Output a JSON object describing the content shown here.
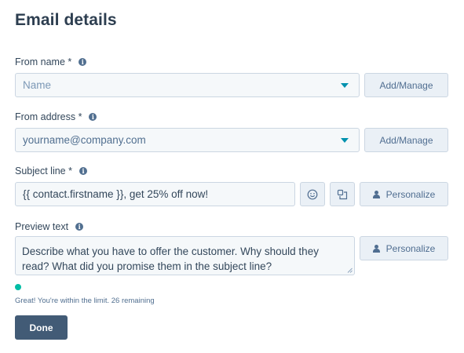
{
  "title": "Email details",
  "from_name": {
    "label": "From name *",
    "placeholder": "Name",
    "button": "Add/Manage"
  },
  "from_address": {
    "label": "From address *",
    "value": "yourname@company.com",
    "button": "Add/Manage"
  },
  "subject": {
    "label": "Subject line *",
    "value": "{{ contact.firstname }}, get 25% off now!",
    "personalize": "Personalize"
  },
  "preview": {
    "label": "Preview text",
    "value": "Describe what you have to offer the customer. Why should they read? What did you promise them in the subject line?",
    "personalize": "Personalize",
    "limit_message": "Great! You're within the limit. 26 remaining"
  },
  "info_glyph": "i",
  "done": "Done",
  "colors": {
    "accent": "#0091ae",
    "success": "#00bda5",
    "primary_button": "#425b76",
    "field_bg": "#f5f8fa",
    "button_bg": "#eaf0f6"
  },
  "icons": [
    "info-icon",
    "caret-down-icon",
    "emoji-icon",
    "snippet-icon",
    "person-icon",
    "resize-handle-icon"
  ]
}
